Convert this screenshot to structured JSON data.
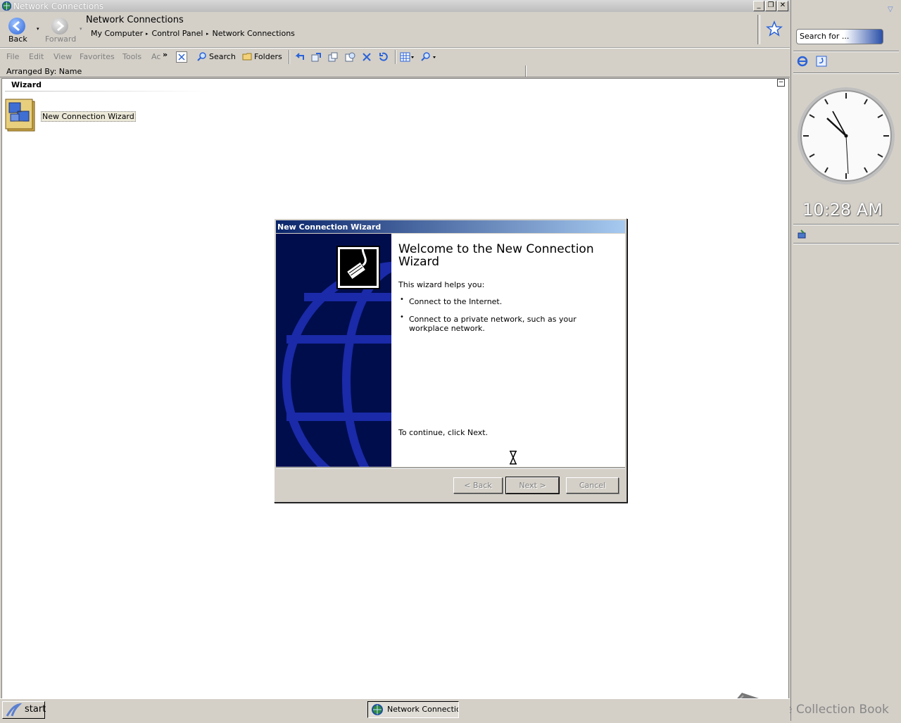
{
  "window": {
    "title": "Network Connections"
  },
  "nav": {
    "back_label": "Back",
    "forward_label": "Forward",
    "location_title": "Network Connections",
    "breadcrumbs": [
      "My Computer",
      "Control Panel",
      "Network Connections"
    ]
  },
  "menu": [
    "File",
    "Edit",
    "View",
    "Favorites",
    "Tools",
    "Ac"
  ],
  "toolbar": {
    "search_label": "Search",
    "folders_label": "Folders"
  },
  "arranged_by": "Arranged By: Name",
  "group": {
    "title": "Wizard",
    "item_label": "New Connection Wizard"
  },
  "dialog": {
    "title": "New Connection Wizard",
    "heading": "Welcome to the New Connection Wizard",
    "intro": "This wizard helps you:",
    "bullets": [
      "Connect to the Internet.",
      "Connect to a private network, such as your workplace network."
    ],
    "continue_text": "To continue, click Next.",
    "buttons": {
      "back": "< Back",
      "next": "Next >",
      "cancel": "Cancel"
    }
  },
  "sidebar": {
    "search_placeholder": "Search for ...",
    "clock_time": "10:28 AM"
  },
  "taskbar": {
    "start_label": "start",
    "task_label": "Network Connection"
  },
  "watermark": "The Collection Book",
  "colors": {
    "dialog_title": "#0a246a",
    "wizard_panel": "#000d4d",
    "globe": "#1a2aa8"
  }
}
